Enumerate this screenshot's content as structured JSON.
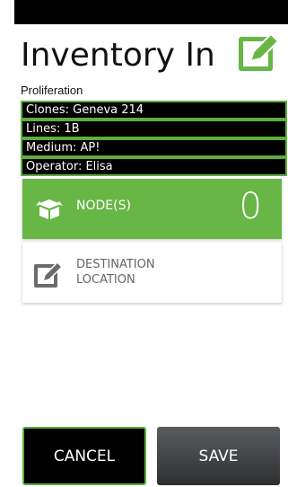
{
  "header": {
    "title": "Inventory In",
    "subtitle": "Proliferation"
  },
  "info": [
    "Clones: Geneva 214",
    "Lines: 1B",
    "Medium: AP!",
    "Operator: Elisa"
  ],
  "node": {
    "label": "NODE(S)",
    "count": "0"
  },
  "destination": {
    "label": "DESTINATION LOCATION"
  },
  "buttons": {
    "cancel": "CANCEL",
    "save": "SAVE"
  },
  "colors": {
    "accent": "#67b646",
    "border": "#5cae3e"
  },
  "icons": {
    "title": "checkbox-edit-icon",
    "node": "box-icon",
    "destination": "edit-icon"
  }
}
